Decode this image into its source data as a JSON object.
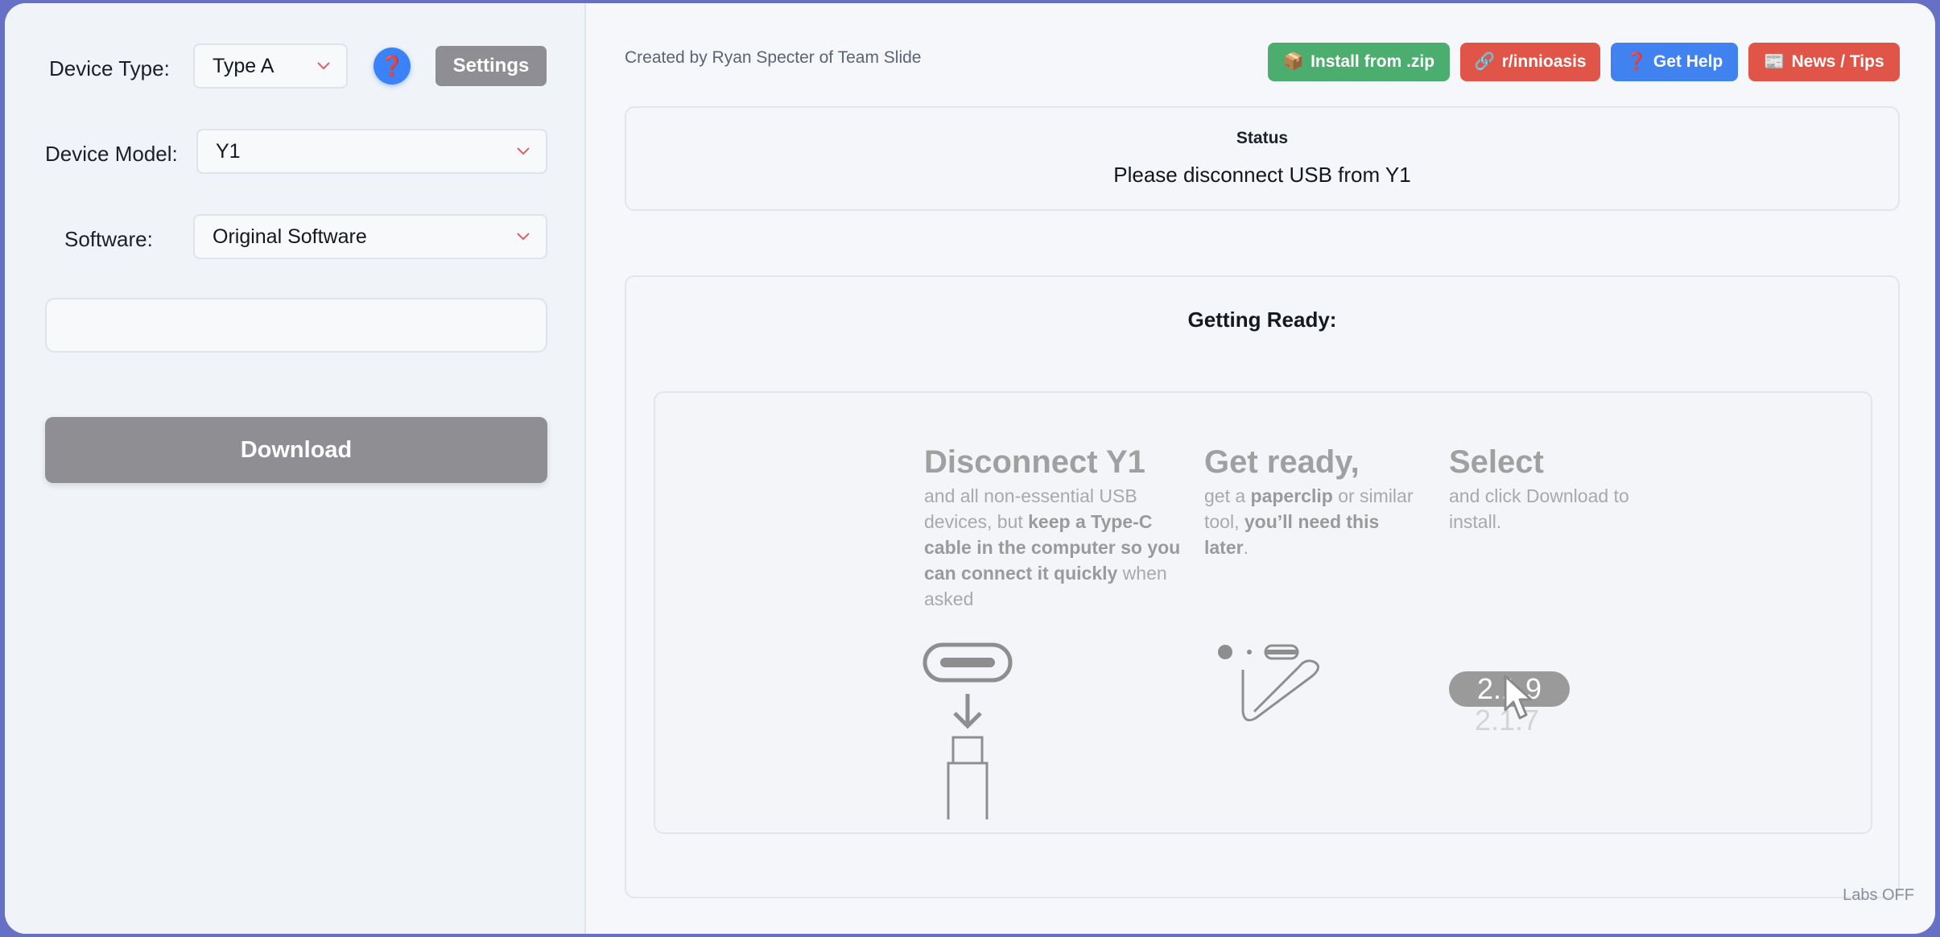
{
  "left": {
    "device_type_label": "Device Type:",
    "device_type_value": "Type A",
    "help_icon": "❓",
    "settings_label": "Settings",
    "device_model_label": "Device Model:",
    "device_model_value": "Y1",
    "software_label": "Software:",
    "software_value": "Original Software",
    "text_box_value": "",
    "download_label": "Download"
  },
  "header": {
    "credit": "Created by Ryan Specter of Team Slide",
    "buttons": [
      {
        "icon": "📦",
        "label": "Install from .zip",
        "color": "#4cae6e"
      },
      {
        "icon": "🔗",
        "label": "r/innioasis",
        "color": "#e05548"
      },
      {
        "icon": "❓",
        "label": "Get Help",
        "color": "#3f82f0"
      },
      {
        "icon": "📰",
        "label": "News / Tips",
        "color": "#e05548"
      }
    ]
  },
  "status": {
    "title": "Status",
    "text": "Please disconnect USB from Y1"
  },
  "ready": {
    "title": "Getting Ready:",
    "steps": [
      {
        "heading": "Disconnect Y1",
        "text_parts": [
          "and all non-essential USB devices, but ",
          "keep a Type-C cable in the computer so you can connect it quickly",
          " when asked"
        ],
        "icon": "usb-c-cable-icon"
      },
      {
        "heading": "Get ready,",
        "text_parts": [
          "get a ",
          "paperclip",
          " or similar tool, ",
          "you’ll need this later",
          "."
        ],
        "icon": "paperclip-icon"
      },
      {
        "heading": "Select",
        "text_parts": [
          "and click Download to install."
        ],
        "version_selected": "2.1.9",
        "version_other": "2.1.7",
        "icon": "cursor-icon"
      }
    ]
  },
  "labs": "Labs OFF",
  "colors": {
    "accent_blue": "#3b82f6",
    "disabled_gray": "#8e8e93",
    "chevron": "#e35d6a"
  }
}
